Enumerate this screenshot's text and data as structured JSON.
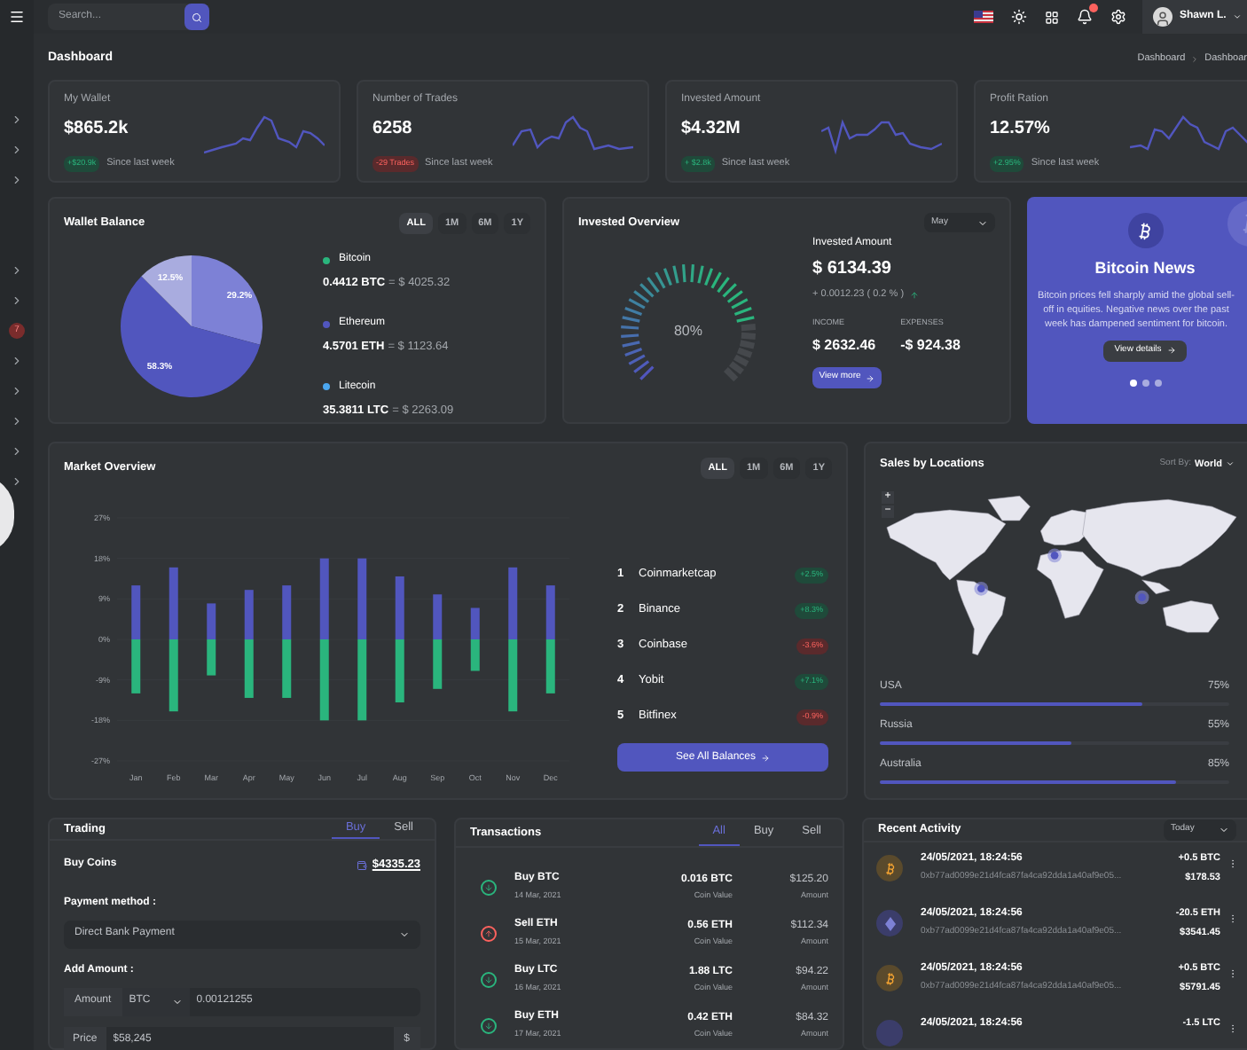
{
  "search": {
    "placeholder": "Search..."
  },
  "user": {
    "name": "Shawn L."
  },
  "sidebar": {
    "badge": "7"
  },
  "page": {
    "title": "Dashboard",
    "breadcrumb": [
      "Dashboard",
      "Dashboar"
    ]
  },
  "stats": [
    {
      "label": "My Wallet",
      "value": "$865.2k",
      "change": "+$20.9k",
      "kind": "gain",
      "note": "Since last week"
    },
    {
      "label": "Number of Trades",
      "value": "6258",
      "change": "-29 Trades",
      "kind": "loss",
      "note": "Since last week"
    },
    {
      "label": "Invested Amount",
      "value": "$4.32M",
      "change": "+ $2.8k",
      "kind": "gain",
      "note": "Since last week"
    },
    {
      "label": "Profit Ration",
      "value": "12.57%",
      "change": "+2.95%",
      "kind": "gain",
      "note": "Since last week"
    }
  ],
  "wallet": {
    "title": "Wallet Balance",
    "tabs": [
      {
        "label": "ALL",
        "selected": true
      },
      {
        "label": "1M",
        "selected": false
      },
      {
        "label": "6M",
        "selected": false
      },
      {
        "label": "1Y",
        "selected": false
      }
    ],
    "chart_data": {
      "type": "pie",
      "values": [
        29.2,
        58.3,
        12.5
      ],
      "value_labels": [
        "29.2%",
        "58.3%",
        "12.5%"
      ]
    },
    "legend": [
      {
        "name": "Bitcoin",
        "color": "#2ab57d",
        "amount": "0.4412 BTC",
        "value": "= $ 4025.32"
      },
      {
        "name": "Ethereum",
        "color": "#5156be",
        "amount": "4.5701 ETH",
        "value": "= $ 1123.64"
      },
      {
        "name": "Litecoin",
        "color": "#4ba6ef",
        "amount": "35.3811 LTC",
        "value": "= $ 2263.09"
      }
    ]
  },
  "invested": {
    "title": "Invested Overview",
    "period": "May",
    "gauge": {
      "level": 0.8,
      "reading": "80%"
    },
    "amount_label": "Invested Amount",
    "amount": "$ 6134.39",
    "change": "+ 0.0012.23 ( 0.2 % )",
    "income_label": "INCOME",
    "income": "$ 2632.46",
    "expenses_label": "EXPENSES",
    "expenses": "-$ 924.38",
    "button": "View more"
  },
  "news": {
    "title": "Bitcoin News",
    "text": "Bitcoin prices fell sharply amid the global sell-off in equities. Negative news over the past week has dampened sentiment for bitcoin.",
    "button": "View details",
    "slides": [
      {
        "selected": true
      },
      {
        "selected": false
      },
      {
        "selected": false
      }
    ]
  },
  "market": {
    "title": "Market Overview",
    "tabs": [
      {
        "label": "ALL",
        "selected": true
      },
      {
        "label": "1M",
        "selected": false
      },
      {
        "label": "6M",
        "selected": false
      },
      {
        "label": "1Y",
        "selected": false
      }
    ],
    "chart_data": {
      "type": "bar",
      "stacked": true,
      "grid": true,
      "categories": [
        "Jan",
        "Feb",
        "Mar",
        "Apr",
        "May",
        "Jun",
        "Jul",
        "Aug",
        "Sep",
        "Oct",
        "Nov",
        "Dec"
      ],
      "series": [
        {
          "color": "#5156be",
          "values": [
            12,
            16,
            8,
            11,
            12,
            18,
            18,
            14,
            10,
            7,
            16,
            12
          ]
        },
        {
          "color": "#2ab57d",
          "values": [
            -12,
            -16,
            -8,
            -13,
            -13,
            -18,
            -18,
            -14,
            -11,
            -7,
            -16,
            -12
          ]
        }
      ],
      "ylim": [
        -27,
        27
      ],
      "yticks": [
        {
          "value": 27,
          "label": "27%"
        },
        {
          "value": 18,
          "label": "18%"
        },
        {
          "value": 9,
          "label": "9%"
        },
        {
          "value": 0,
          "label": "0%"
        },
        {
          "value": -9,
          "label": "-9%"
        },
        {
          "value": -18,
          "label": "-18%"
        },
        {
          "value": -27,
          "label": "-27%"
        }
      ]
    },
    "ranking": [
      {
        "rank": "1",
        "name": "Coinmarketcap",
        "change": "+2.5%",
        "kind": "gain"
      },
      {
        "rank": "2",
        "name": "Binance",
        "change": "+8.3%",
        "kind": "gain"
      },
      {
        "rank": "3",
        "name": "Coinbase",
        "change": "-3.6%",
        "kind": "loss"
      },
      {
        "rank": "4",
        "name": "Yobit",
        "change": "+7.1%",
        "kind": "gain"
      },
      {
        "rank": "5",
        "name": "Bitfinex",
        "change": "-0.9%",
        "kind": "loss"
      }
    ],
    "button": "See All Balances"
  },
  "sales": {
    "title": "Sales by Locations",
    "sort_label": "Sort By:",
    "sort_value": "World",
    "map_controls": [
      "+",
      "−"
    ],
    "locations": [
      {
        "name": "USA",
        "reading": "75%",
        "level": 0.75
      },
      {
        "name": "Russia",
        "reading": "55%",
        "level": 0.55
      },
      {
        "name": "Australia",
        "reading": "85%",
        "level": 0.85
      }
    ]
  },
  "trading": {
    "title": "Trading",
    "tabs": [
      {
        "label": "Buy",
        "selected": true
      },
      {
        "label": "Sell",
        "selected": false
      }
    ],
    "subtitle": "Buy Coins",
    "balance": "$4335.23",
    "payment_label": "Payment method :",
    "payment_value": "Direct Bank Payment",
    "amount_label": "Add Amount :",
    "amount_addon": "Amount",
    "currency": "BTC",
    "amount_value": "0.00121255",
    "price_addon": "Price",
    "price_value": "$58,245",
    "price_suffix": "$"
  },
  "transactions": {
    "title": "Transactions",
    "tabs": [
      {
        "label": "All",
        "selected": true
      },
      {
        "label": "Buy",
        "selected": false
      },
      {
        "label": "Sell",
        "selected": false
      }
    ],
    "rows": [
      {
        "kind": "buy",
        "title": "Buy BTC",
        "date": "14 Mar, 2021",
        "coin": "0.016 BTC",
        "coin_label": "Coin Value",
        "amount": "$125.20",
        "amount_label": "Amount"
      },
      {
        "kind": "sell",
        "title": "Sell ETH",
        "date": "15 Mar, 2021",
        "coin": "0.56 ETH",
        "coin_label": "Coin Value",
        "amount": "$112.34",
        "amount_label": "Amount"
      },
      {
        "kind": "buy",
        "title": "Buy LTC",
        "date": "16 Mar, 2021",
        "coin": "1.88 LTC",
        "coin_label": "Coin Value",
        "amount": "$94.22",
        "amount_label": "Amount"
      },
      {
        "kind": "buy",
        "title": "Buy ETH",
        "date": "17 Mar, 2021",
        "coin": "0.42 ETH",
        "coin_label": "Coin Value",
        "amount": "$84.32",
        "amount_label": "Amount"
      }
    ]
  },
  "activity": {
    "title": "Recent Activity",
    "period": "Today",
    "rows": [
      {
        "kind": "btc",
        "time": "24/05/2021, 18:24:56",
        "hash": "0xb77ad0099e21d4fca87fa4ca92dda1a40af9e05...",
        "change": "+0.5 BTC",
        "value": "$178.53"
      },
      {
        "kind": "eth",
        "time": "24/05/2021, 18:24:56",
        "hash": "0xb77ad0099e21d4fca87fa4ca92dda1a40af9e05...",
        "change": "-20.5 ETH",
        "value": "$3541.45"
      },
      {
        "kind": "btc",
        "time": "24/05/2021, 18:24:56",
        "hash": "0xb77ad0099e21d4fca87fa4ca92dda1a40af9e05...",
        "change": "+0.5 BTC",
        "value": "$5791.45"
      },
      {
        "kind": "ltc",
        "time": "24/05/2021, 18:24:56",
        "change": "-1.5 LTC"
      }
    ]
  }
}
